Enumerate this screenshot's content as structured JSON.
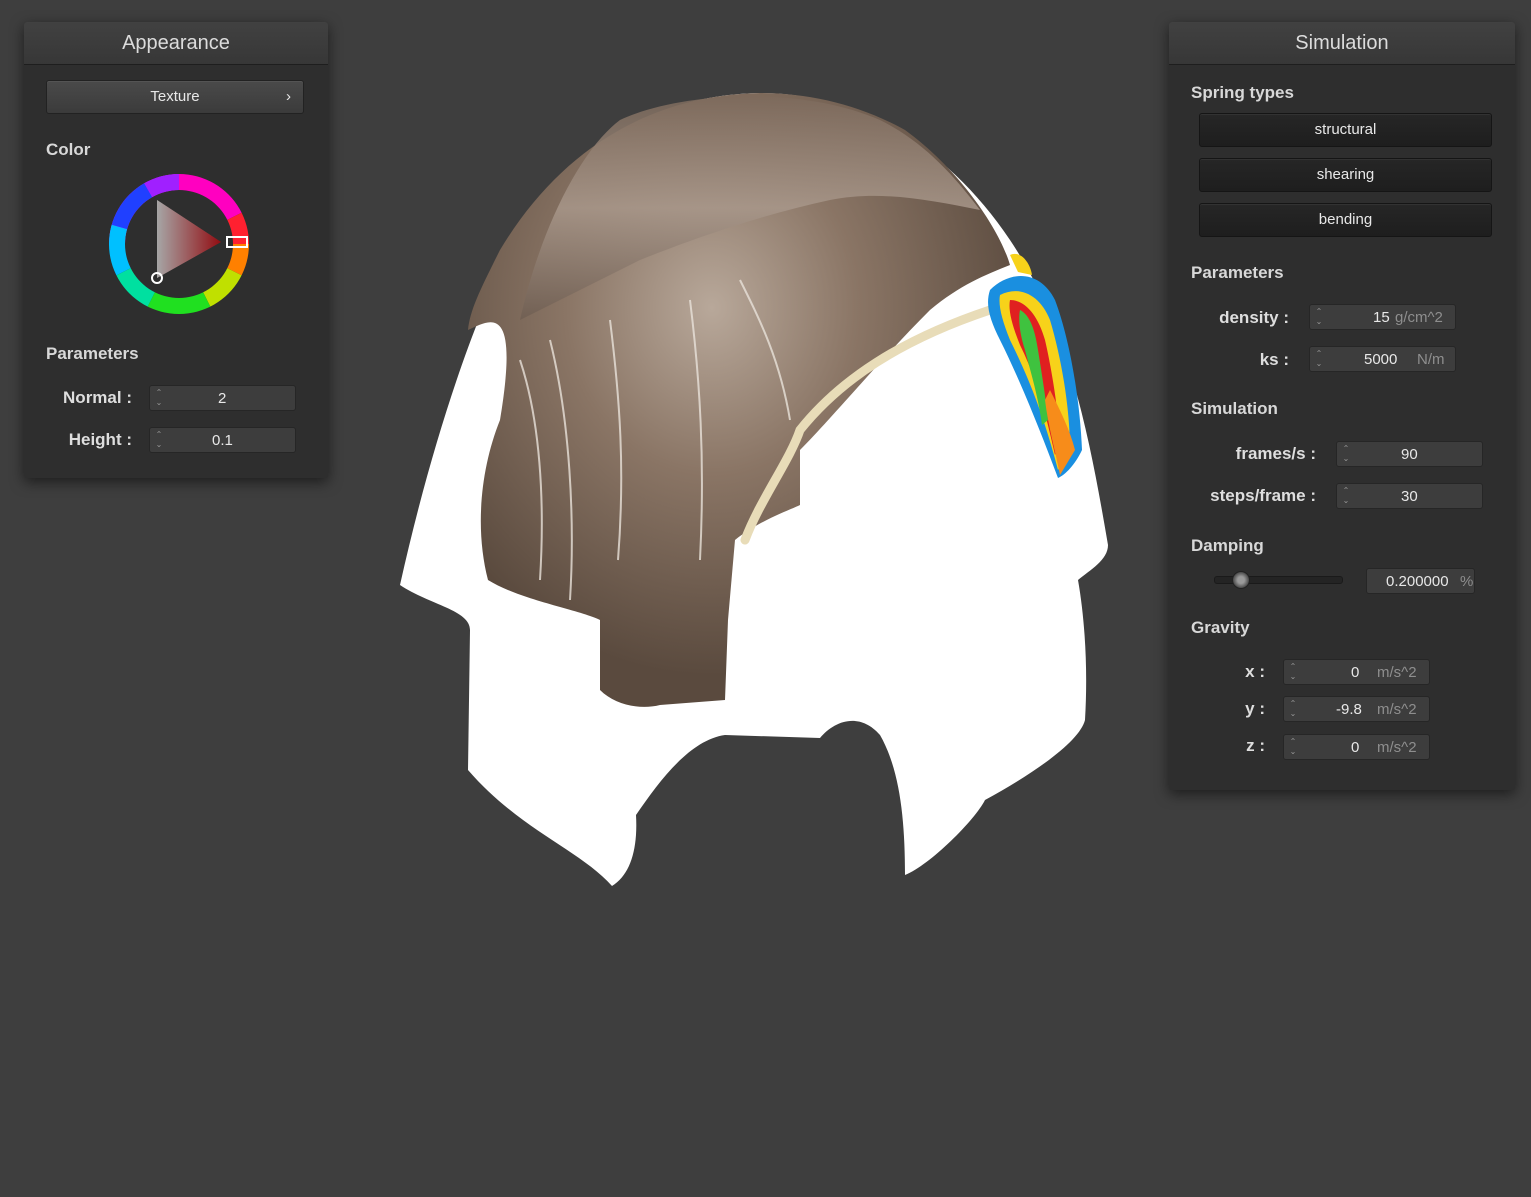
{
  "appearance": {
    "title": "Appearance",
    "texture_button": "Texture",
    "texture_chevron": "›",
    "color_label": "Color",
    "parameters_label": "Parameters",
    "normal_label": "Normal :",
    "normal_value": "2",
    "height_label": "Height :",
    "height_value": "0.1",
    "selected_color": "#e0141c"
  },
  "simulation": {
    "title": "Simulation",
    "spring_types_label": "Spring types",
    "springs": [
      "structural",
      "shearing",
      "bending"
    ],
    "parameters_label": "Parameters",
    "density_label": "density :",
    "density_value": "15",
    "density_unit": "g/cm^2",
    "ks_label": "ks :",
    "ks_value": "5000",
    "ks_unit": "N/m",
    "simulation_label": "Simulation",
    "fps_label": "frames/s :",
    "fps_value": "90",
    "steps_label": "steps/frame :",
    "steps_value": "30",
    "damping_label": "Damping",
    "damping_value": "0.200000",
    "damping_unit": "%",
    "damping_fraction": 0.2,
    "gravity_label": "Gravity",
    "gx_label": "x :",
    "gx_value": "0",
    "gy_label": "y :",
    "gy_value": "-9.8",
    "gz_label": "z :",
    "gz_value": "0",
    "gravity_unit": "m/s^2"
  },
  "viewport": {
    "background": "#3e3e3e",
    "cloth_color": "#ffffff"
  }
}
